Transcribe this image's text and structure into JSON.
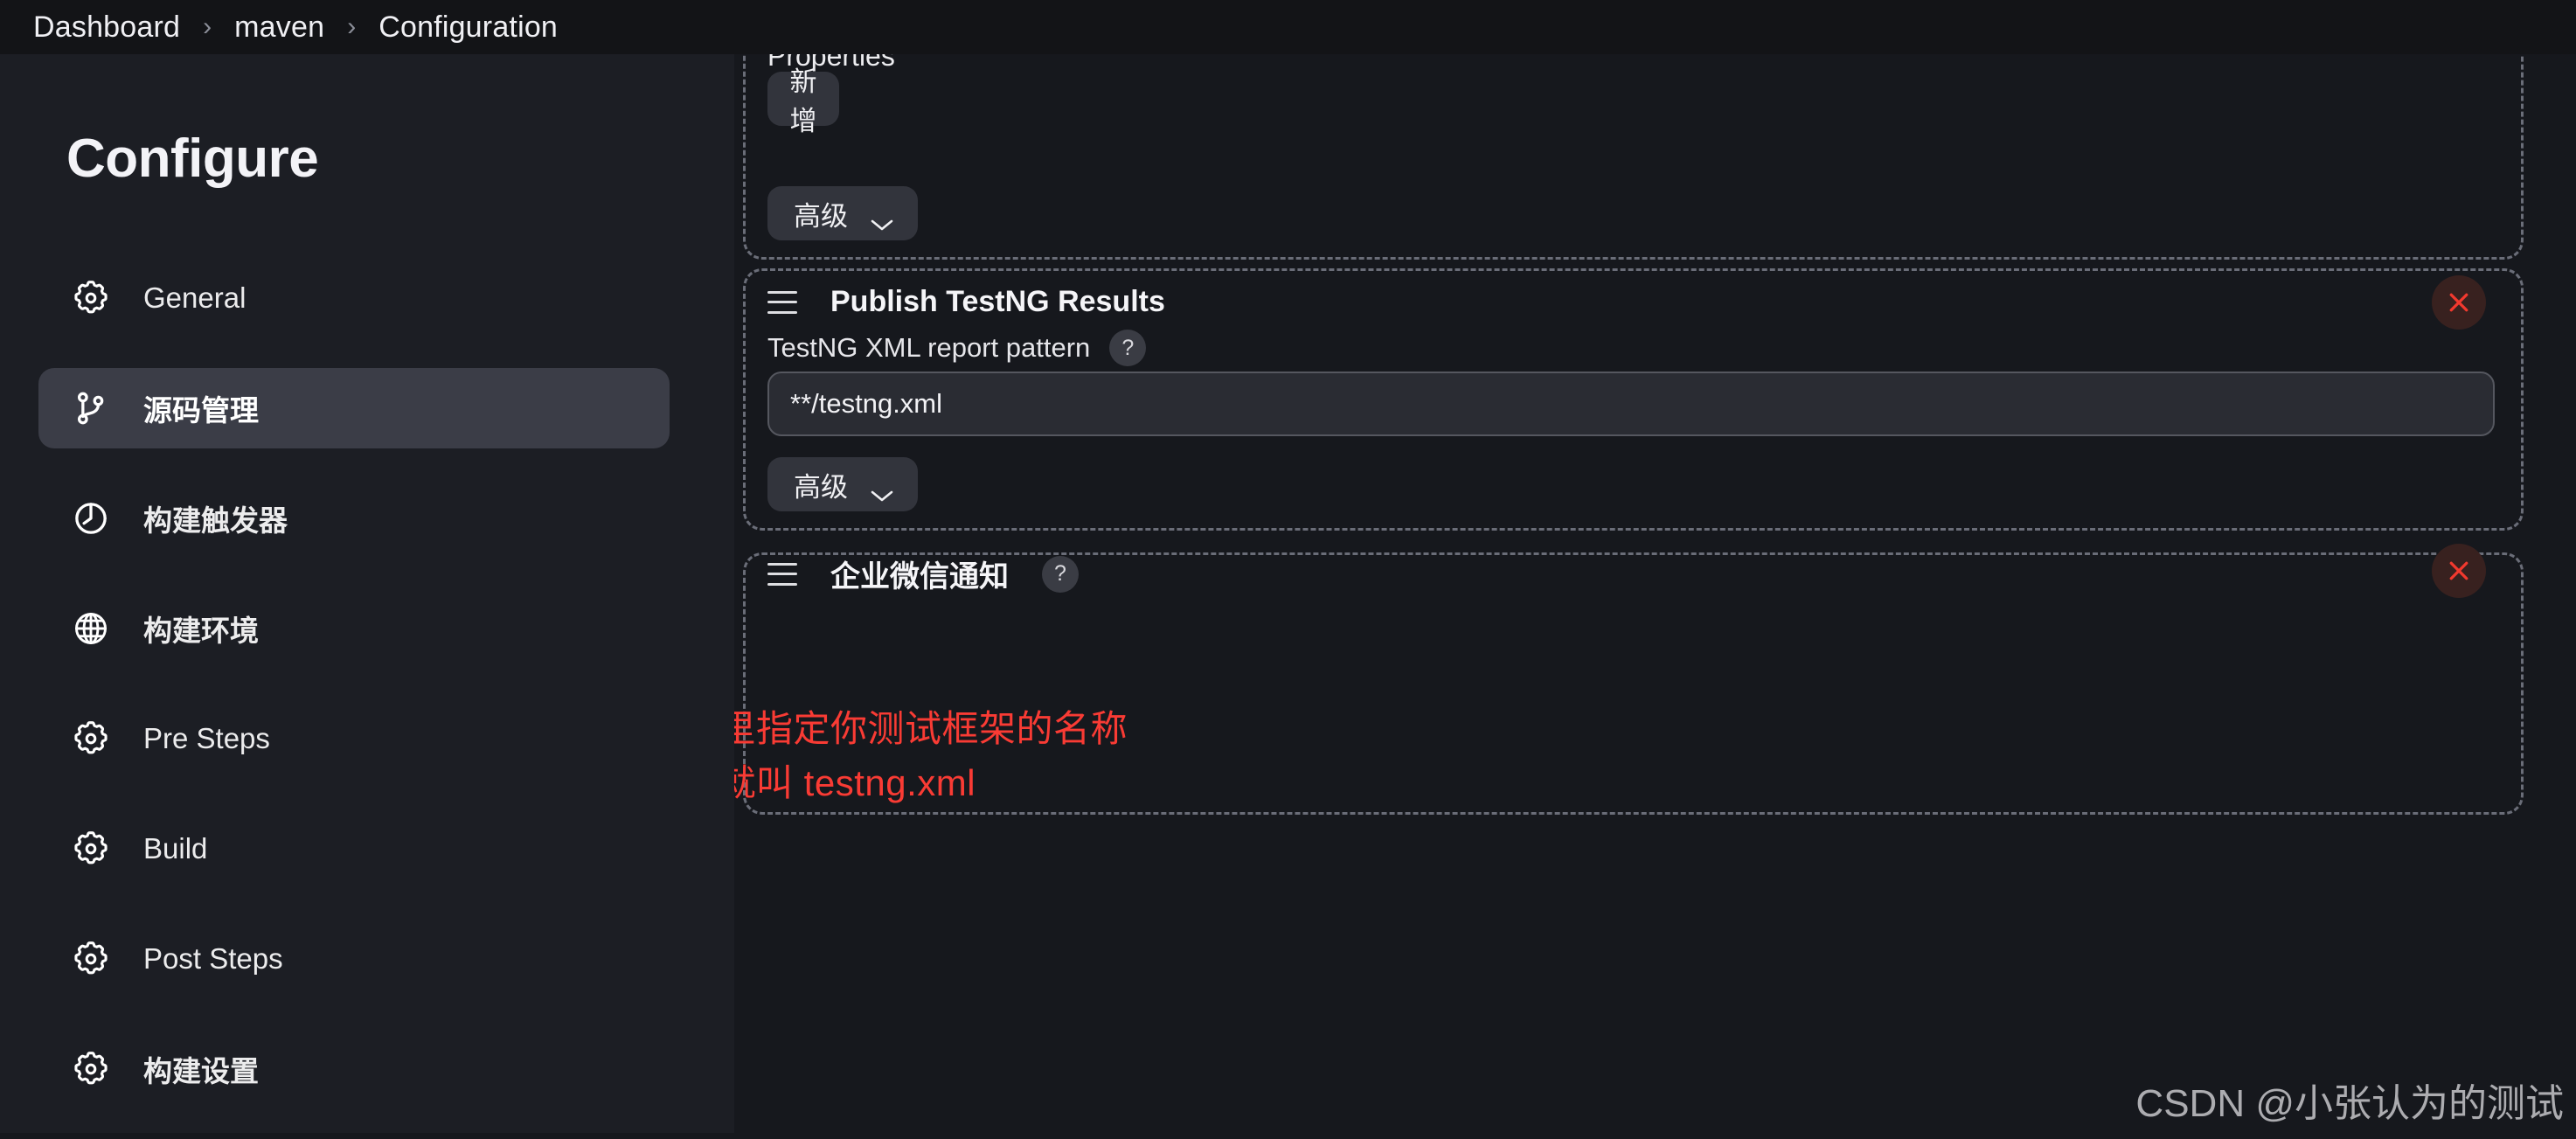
{
  "breadcrumb": {
    "items": [
      "Dashboard",
      "maven",
      "Configuration"
    ],
    "separator": "›"
  },
  "sidebar": {
    "title": "Configure",
    "items": [
      {
        "label": "General",
        "icon": "gear-icon",
        "selected": false
      },
      {
        "label": "源码管理",
        "icon": "git-branch-icon",
        "selected": true
      },
      {
        "label": "构建触发器",
        "icon": "clock-icon",
        "selected": false
      },
      {
        "label": "构建环境",
        "icon": "globe-icon",
        "selected": false
      },
      {
        "label": "Pre Steps",
        "icon": "gear-icon",
        "selected": false
      },
      {
        "label": "Build",
        "icon": "gear-icon",
        "selected": false
      },
      {
        "label": "Post Steps",
        "icon": "gear-icon",
        "selected": false
      },
      {
        "label": "构建设置",
        "icon": "gear-icon",
        "selected": false
      }
    ]
  },
  "main": {
    "properties_section": {
      "title": "Properties",
      "add_button": "新增",
      "advanced_button": "高级"
    },
    "testng_section": {
      "title": "Publish TestNG Results",
      "field_label": "TestNG XML report pattern",
      "help": "?",
      "field_value": "**/testng.xml",
      "field_placeholder": "**/testng.xml",
      "advanced_button": "高级",
      "close": "×"
    },
    "wechat_section": {
      "title": "企业微信通知",
      "help": "?"
    }
  },
  "annotations": {
    "line1": "这里指定你测试框架的名称",
    "line2": "我就叫 testng.xml",
    "color": "#f93b34"
  },
  "watermark": "CSDN @小张认为的测试"
}
